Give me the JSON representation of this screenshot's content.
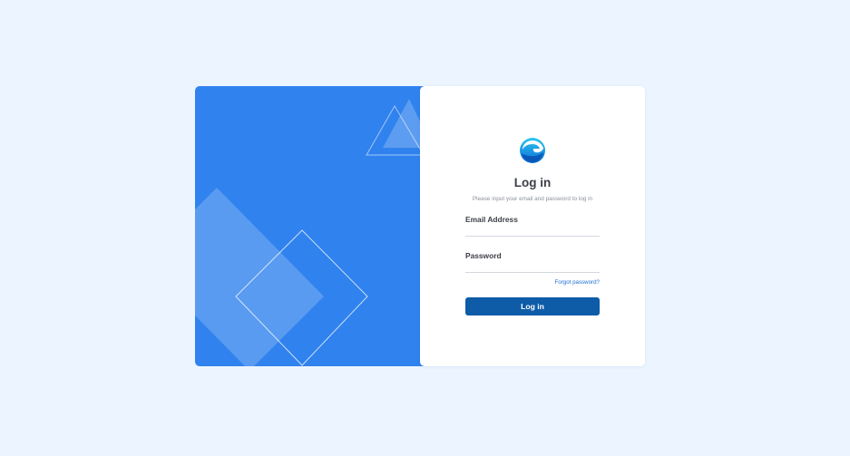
{
  "colors": {
    "page_background": "#ecf5ff",
    "panel_blue": "#3082ee",
    "button": "#0e5ba8",
    "link": "#1a6fd0"
  },
  "brand": {
    "logo_icon": "globe-logo-icon"
  },
  "login": {
    "title": "Log in",
    "subtitle": "Please input your email and password to log in",
    "email_label": "Email Address",
    "email_value": "",
    "email_placeholder": "",
    "password_label": "Password",
    "password_value": "",
    "password_placeholder": "",
    "forgot_label": "Forgot password?",
    "submit_label": "Log in"
  }
}
